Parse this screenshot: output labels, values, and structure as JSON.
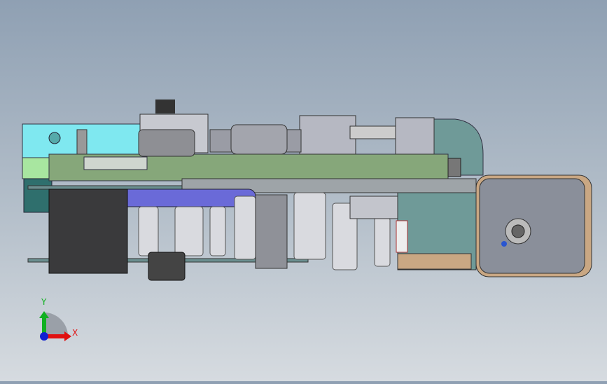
{
  "viewport": {
    "triad": {
      "x_label": "X",
      "y_label": "Y"
    },
    "colors": {
      "x_axis": "#e01010",
      "y_axis": "#10b020",
      "z_axis": "#1020d0",
      "background_top": "#8fa0b3",
      "background_bottom": "#d6dbe0"
    }
  }
}
